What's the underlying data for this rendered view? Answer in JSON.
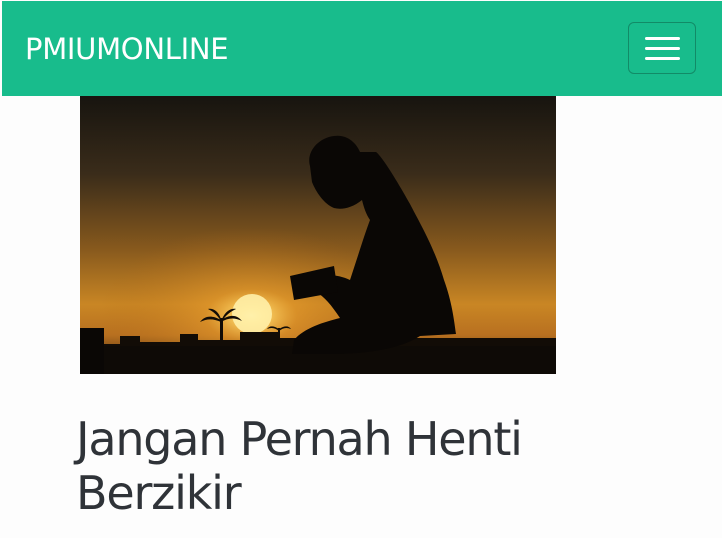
{
  "navbar": {
    "brand": "PMIUMONLINE",
    "toggle_icon": "hamburger-menu-icon",
    "background_color": "#18bc8c"
  },
  "article": {
    "image_description_icon": "silhouette-man-reading-quran-sunset-image",
    "title": "Jangan Pernah Henti Berzikir"
  }
}
